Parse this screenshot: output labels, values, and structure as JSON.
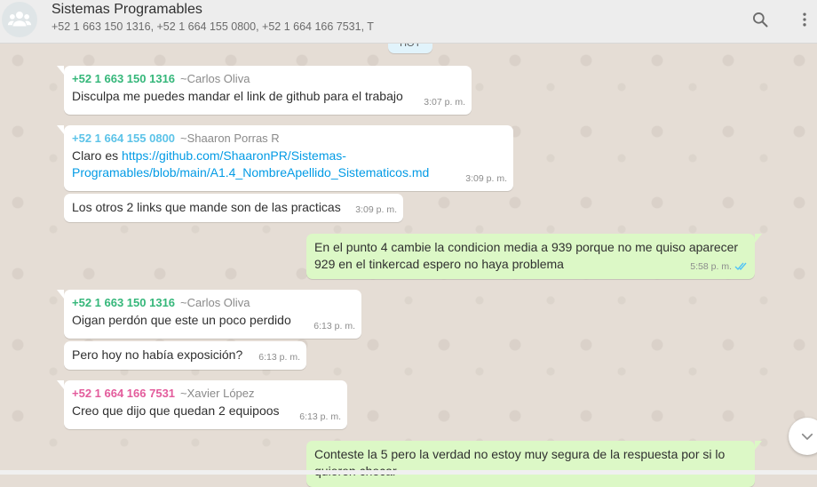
{
  "header": {
    "title": "Sistemas Programables",
    "members": "+52 1 663 150 1316, +52 1 664 155 0800, +52 1 664 166 7531, T",
    "icons": {
      "avatar": "group-icon",
      "search": "search-icon",
      "menu": "more-vertical-icon"
    }
  },
  "datechip": {
    "label": "HOY"
  },
  "messages": {
    "m1": {
      "number": "+52 1 663 150 1316",
      "nick": "~Carlos Oliva",
      "text": "Disculpa me puedes mandar el link de github para el trabajo",
      "time": "3:07 p. m.",
      "color": "#35b77a"
    },
    "m2": {
      "number": "+52 1 664 155 0800",
      "nick": "~Shaaron Porras R",
      "prefix": "Claro es ",
      "link_part1": "https://github.com/ShaaronPR/Sistemas-",
      "link_part2": "Programables/blob/main/A1.4_NombreApellido_Sistematicos.md",
      "time": "3:09 p. m.",
      "color": "#5cc3e8"
    },
    "m3": {
      "text": "Los otros 2 links que mande son de las practicas",
      "time": "3:09 p. m."
    },
    "m4": {
      "text_line1": "En el punto 4 cambie la condicion media a 939 porque no me quiso aparecer",
      "text_line2": "929 en el tinkercad espero no haya problema",
      "time": "5:58 p. m."
    },
    "m5": {
      "number": "+52 1 663 150 1316",
      "nick": "~Carlos Oliva",
      "text": "Oigan perdón que este un poco perdido",
      "time": "6:13 p. m.",
      "color": "#35b77a"
    },
    "m6": {
      "text": "Pero hoy no había exposición?",
      "time": "6:13 p. m."
    },
    "m7": {
      "number": "+52 1 664 166 7531",
      "nick": "~Xavier López",
      "text": "Creo que dijo que quedan 2 equipoos",
      "time": "6:13 p. m.",
      "color": "#e35c9c"
    },
    "m8": {
      "text_line1": "Conteste la 5 pero la verdad no estoy muy segura de la respuesta por si lo",
      "text_line2": "quieren checar"
    }
  },
  "colors": {
    "outgoing": "#dcf8c6",
    "incoming": "#ffffff",
    "read_ticks": "#4fc3f7",
    "background": "#e5ddd5"
  }
}
